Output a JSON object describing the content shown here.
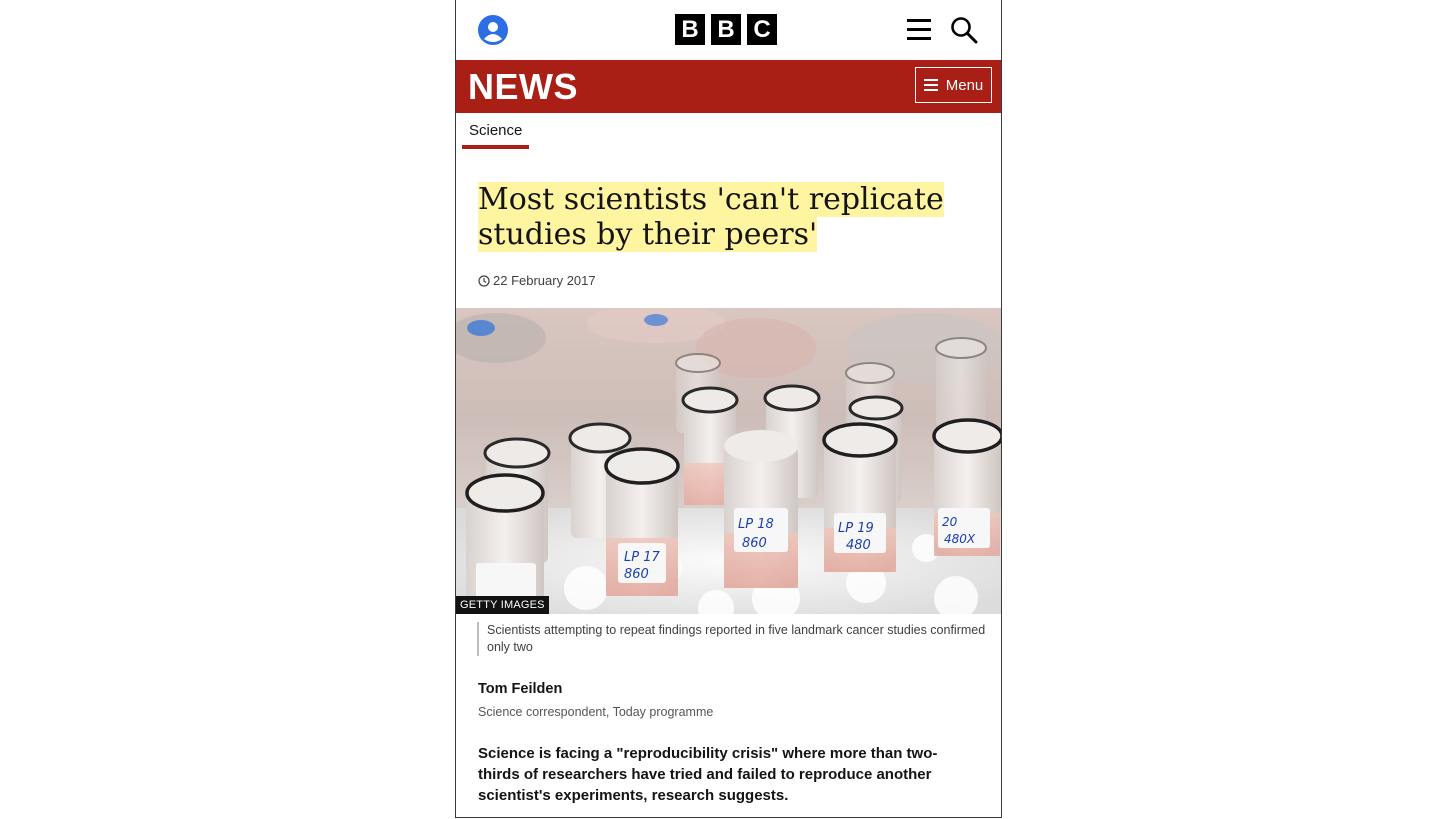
{
  "header": {
    "account_icon": "account-icon",
    "logo_letters": [
      "B",
      "B",
      "C"
    ],
    "menu_icon": "hamburger-icon",
    "search_icon": "search-icon"
  },
  "newsbar": {
    "title": "NEWS",
    "menu_label": "Menu",
    "color": "#a91f16"
  },
  "section": {
    "label": "Science"
  },
  "article": {
    "headline": "Most scientists 'can't replicate studies by their peers'",
    "date": "22 February 2017",
    "image_credit": "GETTY IMAGES",
    "image_caption": "Scientists attempting to repeat findings reported in five landmark cancer studies confirmed only two",
    "author_name": "Tom Feilden",
    "author_role": "Science correspondent, Today programme",
    "intro": "Science is facing a \"reproducibility crisis\" where more than two-thirds of researchers have tried and failed to reproduce another scientist's experiments, research suggests."
  },
  "tube_labels": [
    {
      "line1": "LP 17",
      "line2": "860"
    },
    {
      "line1": "LP 18",
      "line2": "860"
    },
    {
      "line1": "LP 19",
      "line2": "480"
    },
    {
      "line1": "20",
      "line2": "480X"
    }
  ]
}
